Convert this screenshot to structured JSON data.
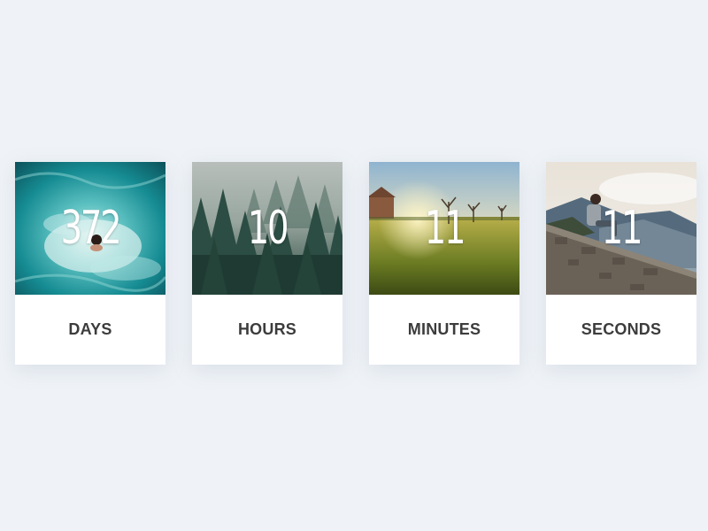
{
  "countdown": {
    "units": [
      {
        "value": "372",
        "label": "DAYS",
        "photo": "ocean-swimmer-photo"
      },
      {
        "value": "10",
        "label": "HOURS",
        "photo": "misty-forest-photo"
      },
      {
        "value": "11",
        "label": "MINUTES",
        "photo": "sunlit-meadow-photo"
      },
      {
        "value": "11",
        "label": "SECONDS",
        "photo": "man-on-stone-wall-photo"
      }
    ]
  },
  "colors": {
    "background": "#eff3f7",
    "card": "#ffffff",
    "label_text": "#3c3c3c",
    "value_text": "#ffffff"
  }
}
